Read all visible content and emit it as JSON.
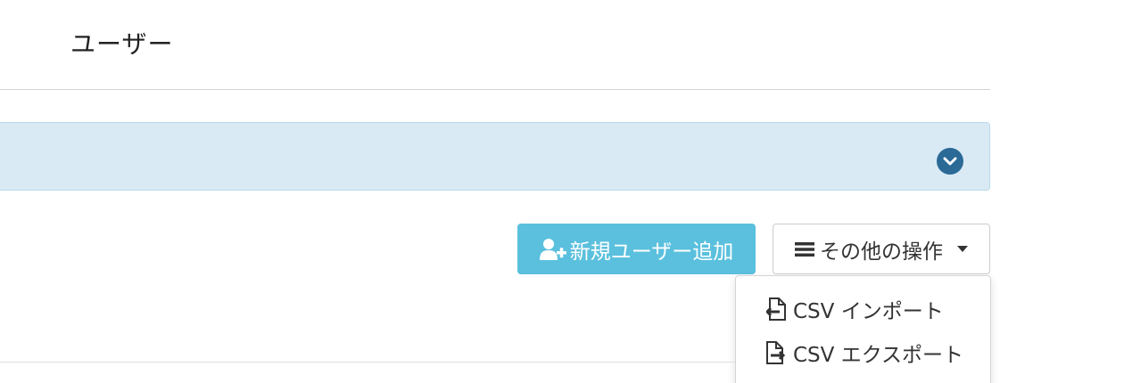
{
  "page": {
    "title": "ユーザー"
  },
  "filter_panel": {
    "toggle_icon": "chevron-down-circle-icon",
    "color": "#d9eaf5",
    "toggle_color": "#2b6a96"
  },
  "toolbar": {
    "add_user": {
      "label": "新規ユーザー追加",
      "icon": "user-plus-icon",
      "color": "#5bc0de"
    },
    "more_actions": {
      "label": "その他の操作",
      "icon": "bars-icon"
    }
  },
  "dropdown": {
    "items": [
      {
        "label": "CSV インポート",
        "icon": "file-import-icon"
      },
      {
        "label": "CSV エクスポート",
        "icon": "file-export-icon"
      }
    ]
  }
}
